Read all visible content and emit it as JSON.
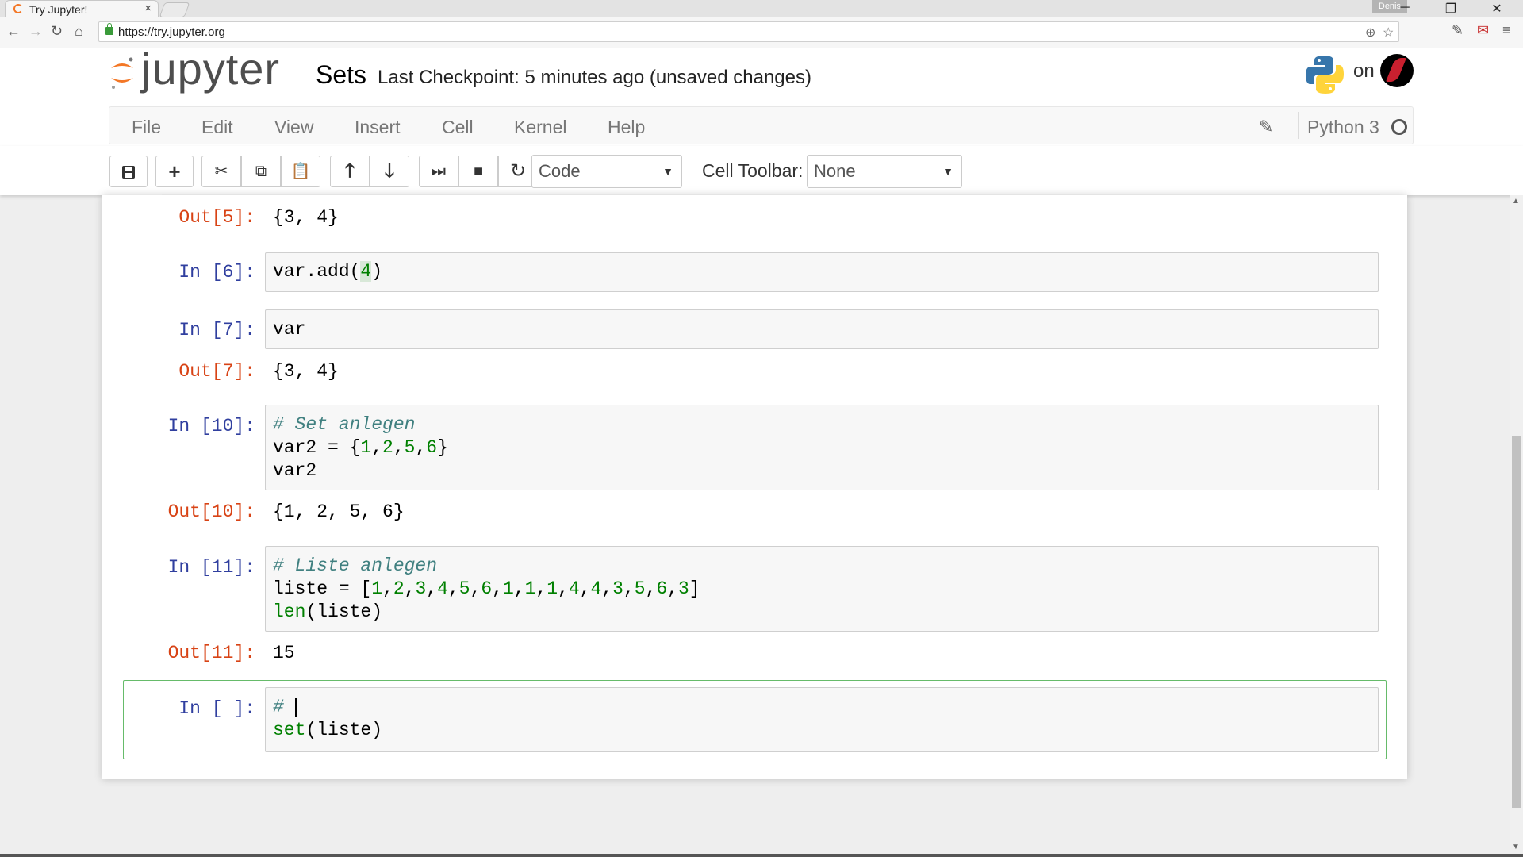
{
  "browser": {
    "tab_title": "Try Jupyter!",
    "tab_close": "×",
    "profile": "Denis",
    "url": "https://try.jupyter.org",
    "window_buttons": [
      "─",
      "❐",
      "✕"
    ]
  },
  "header": {
    "logo_text": "jupyter",
    "notebook_name": "Sets",
    "checkpoint": "Last Checkpoint: 5 minutes ago (unsaved changes)",
    "on_text": "on"
  },
  "menubar": {
    "items": [
      "File",
      "Edit",
      "View",
      "Insert",
      "Cell",
      "Kernel",
      "Help"
    ],
    "kernel_name": "Python 3"
  },
  "toolbar": {
    "cell_type": "Code",
    "cell_toolbar_label": "Cell Toolbar:",
    "cell_toolbar_value": "None"
  },
  "cells": [
    {
      "out_prompt": "Out[5]:",
      "output": "{3, 4}"
    },
    {
      "in_prompt": "In [6]:"
    },
    {
      "in_prompt": "In [7]:",
      "code": "var",
      "out_prompt": "Out[7]:",
      "output": "{3, 4}"
    },
    {
      "in_prompt": "In [10]:",
      "code_line3": "var2",
      "out_prompt": "Out[10]:",
      "output": "{1, 2, 5, 6}"
    },
    {
      "in_prompt": "In [11]:",
      "out_prompt": "Out[11]:",
      "output": "15"
    },
    {
      "in_prompt": "In [ ]:"
    }
  ],
  "colors": {
    "in_prompt": "#303f9f",
    "out_prompt": "#d84315",
    "selected_border": "#66bb6a",
    "jupyter_orange": "#f37726"
  }
}
